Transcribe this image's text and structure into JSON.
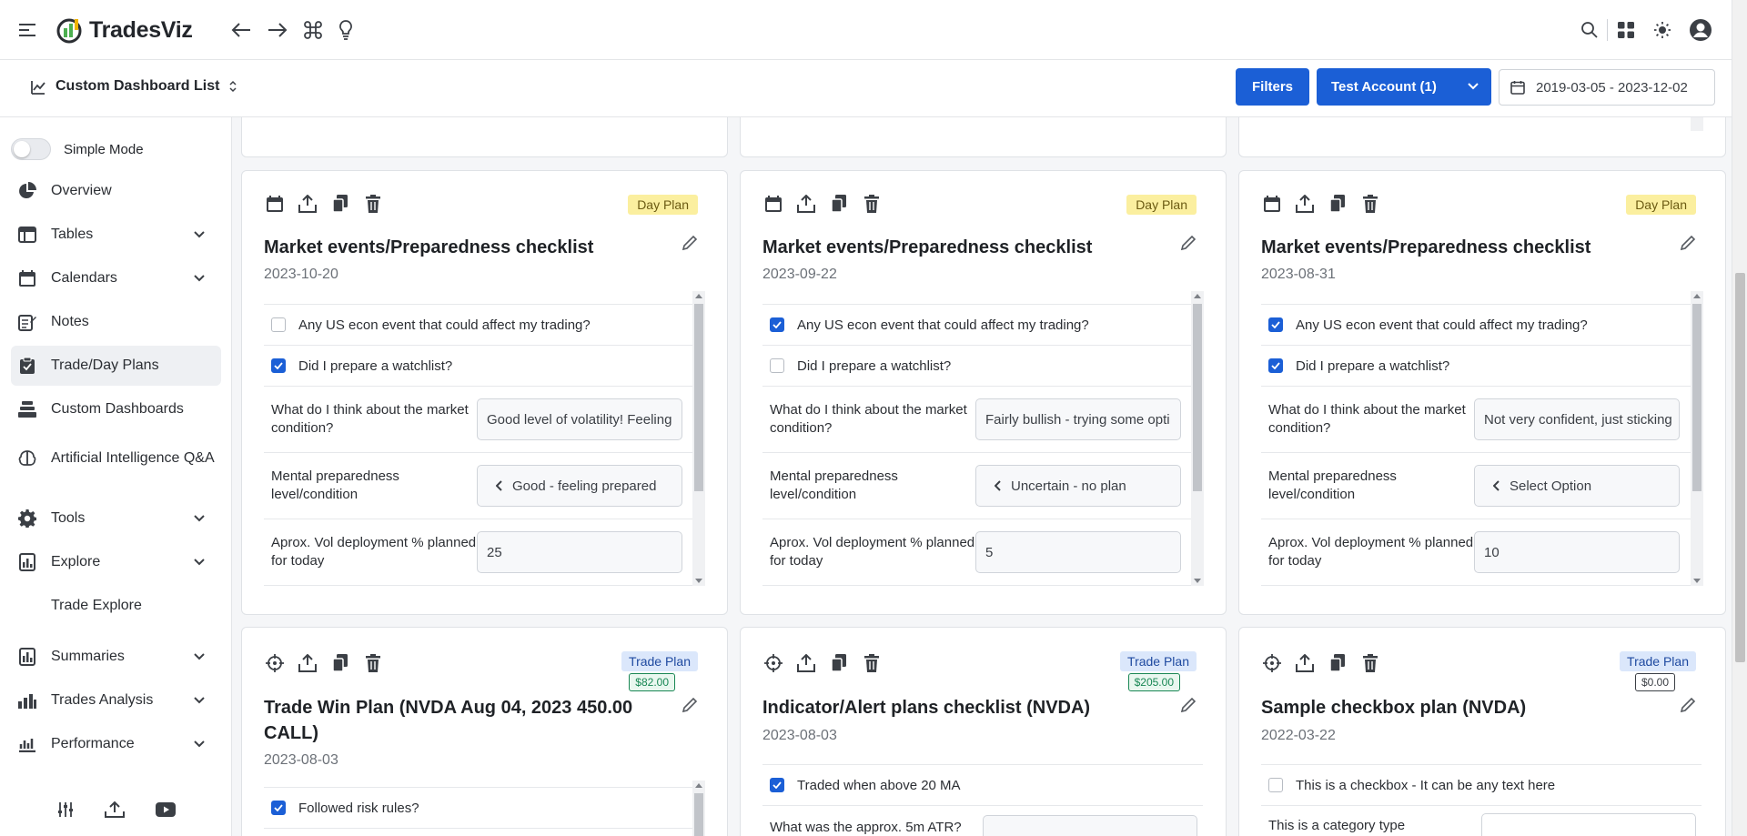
{
  "app": {
    "name": "TradesViz"
  },
  "subbar": {
    "dashboard_list": "Custom Dashboard List",
    "filters": "Filters",
    "account": "Test Account (1)",
    "date_range": "2019-03-05 - 2023-12-02"
  },
  "sidebar": {
    "simple_mode": "Simple Mode",
    "items": [
      {
        "label": "Overview",
        "icon": "pie-chart-icon"
      },
      {
        "label": "Tables",
        "icon": "table-icon"
      },
      {
        "label": "Calendars",
        "icon": "calendar-icon"
      },
      {
        "label": "Notes",
        "icon": "notes-icon"
      },
      {
        "label": "Trade/Day Plans",
        "icon": "clipboard-icon"
      },
      {
        "label": "Custom Dashboards",
        "icon": "layers-icon"
      },
      {
        "label": "Artificial Intelligence Q&A",
        "icon": "brain-icon"
      },
      {
        "label": "Tools",
        "icon": "gear-icon"
      },
      {
        "label": "Explore",
        "icon": "report-icon"
      },
      {
        "label": "Trade Explore",
        "icon": ""
      },
      {
        "label": "Summaries",
        "icon": "summary-icon"
      },
      {
        "label": "Trades Analysis",
        "icon": "analysis-icon"
      },
      {
        "label": "Performance",
        "icon": "performance-icon"
      }
    ]
  },
  "cards": [
    {
      "badge": "Day Plan",
      "title": "Market events/Preparedness checklist",
      "date": "2023-10-20",
      "q1": "Any US econ event that could affect my trading?",
      "q2": "Did I prepare a watchlist?",
      "q3": "What do I think about the market condition?",
      "a3": "Good level of volatility! Feeling",
      "q4": "Mental preparedness level/condition",
      "a4": "Good - feeling prepared",
      "q5": "Aprox. Vol deployment % planned for today",
      "a5": "25"
    },
    {
      "badge": "Day Plan",
      "title": "Market events/Preparedness checklist",
      "date": "2023-09-22",
      "q1": "Any US econ event that could affect my trading?",
      "q2": "Did I prepare a watchlist?",
      "q3": "What do I think about the market condition?",
      "a3": "Fairly bullish - trying some opti",
      "q4": "Mental preparedness level/condition",
      "a4": "Uncertain - no plan",
      "q5": "Aprox. Vol deployment % planned for today",
      "a5": "5"
    },
    {
      "badge": "Day Plan",
      "title": "Market events/Preparedness checklist",
      "date": "2023-08-31",
      "q1": "Any US econ event that could affect my trading?",
      "q2": "Did I prepare a watchlist?",
      "q3": "What do I think about the market condition?",
      "a3": "Not very confident, just sticking",
      "q4": "Mental preparedness level/condition",
      "a4": "Select Option",
      "q5": "Aprox. Vol deployment % planned for today",
      "a5": "10"
    },
    {
      "badge": "Trade Plan",
      "amount": "$82.00",
      "title": "Trade Win Plan (NVDA Aug 04, 2023 450.00 CALL)",
      "date": "2023-08-03",
      "q1": "Followed risk rules?"
    },
    {
      "badge": "Trade Plan",
      "amount": "$205.00",
      "title": "Indicator/Alert plans checklist (NVDA)",
      "date": "2023-08-03",
      "q1": "Traded when above 20 MA",
      "q2": "What was the approx. 5m ATR?"
    },
    {
      "badge": "Trade Plan",
      "amount": "$0.00",
      "title": "Sample checkbox plan (NVDA)",
      "date": "2022-03-22",
      "q1": "This is a checkbox - It can be any text here",
      "q2": "This is a category type"
    }
  ]
}
